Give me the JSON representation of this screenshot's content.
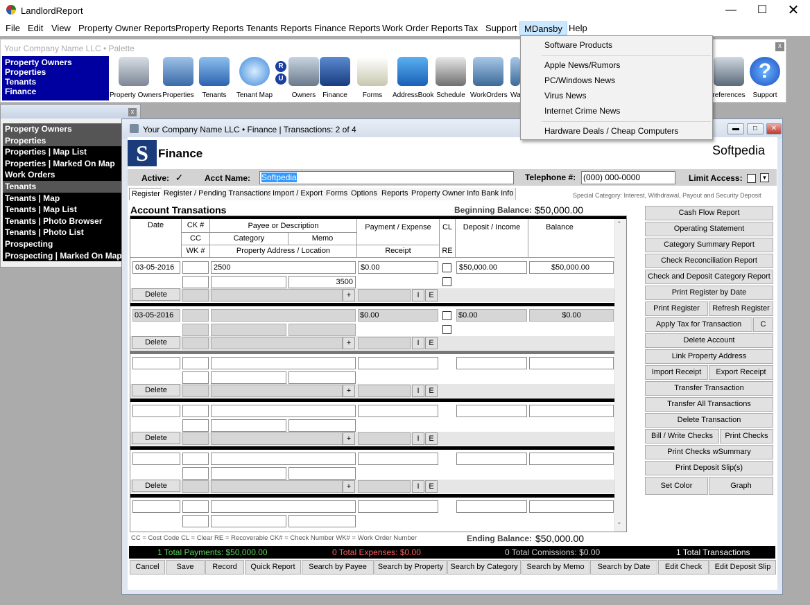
{
  "window": {
    "title": "LandlordReport",
    "min_icon": "minimize-icon",
    "max_icon": "maximize-icon",
    "close_icon": "close-icon"
  },
  "menu": [
    "File",
    "Edit",
    "View",
    "Property Owner Reports",
    "Property Reports",
    "Tenants Reports",
    "Finance Reports",
    "Work Order Reports",
    "Tax",
    "Support",
    "MDansby",
    "Help"
  ],
  "mdansby_menu": [
    "Software Products",
    "Apple News/Rumors",
    "PC/Windows News",
    "Virus News",
    "Internet Crime News",
    "Hardware Deals / Cheap Computers"
  ],
  "palette": {
    "title": "Your Company Name LLC  •  Palette",
    "close": "x",
    "nav": [
      "Property Owners",
      "Properties",
      "Tenants",
      "Finance"
    ],
    "tools": [
      "Property Owners",
      "Properties",
      "Tenants",
      "Tenant Map",
      "Owners",
      "Finance",
      "Forms",
      "AddressBook",
      "Schedule",
      "WorkOrders",
      "Wa",
      "references",
      "Support"
    ],
    "ru_badge": [
      "R",
      "U"
    ]
  },
  "side_nav": {
    "close": "x",
    "items": [
      {
        "label": "Property Owners",
        "type": "hdr"
      },
      {
        "label": "Properties",
        "type": "hdr"
      },
      {
        "label": "Properties | Map List",
        "type": "it"
      },
      {
        "label": "Properties | Marked On Map",
        "type": "it"
      },
      {
        "label": "Work Orders",
        "type": "it"
      },
      {
        "label": "Tenants",
        "type": "hdr"
      },
      {
        "label": "Tenants | Map",
        "type": "it"
      },
      {
        "label": "Tenants | Map List",
        "type": "it"
      },
      {
        "label": "Tenants | Photo Browser",
        "type": "it"
      },
      {
        "label": "Tenants | Photo List",
        "type": "it"
      },
      {
        "label": "Prospecting",
        "type": "it"
      },
      {
        "label": "Prospecting | Marked On Map",
        "type": "it"
      }
    ]
  },
  "finance": {
    "window_title": "Your Company Name LLC  •  Finance | Transactions: 2 of 4",
    "logo_letter": "S",
    "heading": "Finance",
    "brand": "Softpedia",
    "active_label": "Active:",
    "active_checked": "✓",
    "acct_label": "Acct Name:",
    "acct_value": "Softpedia",
    "tel_label": "Telephone #:",
    "tel_value": "(000) 000-0000",
    "limit_label": "Limit Access:",
    "tabs": [
      "Register",
      "Register / Pending Transactions",
      "Import / Export",
      "Forms",
      "Options",
      "Reports",
      "Property Owner Info",
      "Bank Info"
    ],
    "special_category": "Special Category:  Interest, Withdrawal, Payout and Security Deposit",
    "section_title": "Account Transations",
    "beginning_label": "Beginning Balance:",
    "beginning_value": "$50,000.00",
    "ending_label": "Ending Balance:",
    "ending_value": "$50,000.00",
    "columns": {
      "date": "Date",
      "ck": "CK #",
      "cc": "CC",
      "wk": "WK #",
      "payee": "Payee or Description",
      "category": "Category",
      "memo": "Memo",
      "address": "Property Address / Location",
      "payment": "Payment / Expense",
      "receipt": "Receipt",
      "cl": "CL",
      "re": "RE",
      "deposit": "Deposit / Income",
      "balance": "Balance"
    },
    "rows": [
      {
        "date": "03-05-2016",
        "payee": "2500",
        "memo": "3500",
        "payment": "$0.00",
        "deposit": "$50,000.00",
        "balance": "$50,000.00"
      },
      {
        "date": "03-05-2016",
        "payee": "",
        "memo": "",
        "payment": "$0.00",
        "deposit": "$0.00",
        "balance": "$0.00"
      }
    ],
    "row_buttons": {
      "delete": "Delete",
      "plus": "+",
      "i": "I",
      "e": "E"
    },
    "legend": "CC = Cost Code     CL = Clear     RE = Recoverable     CK# = Check Number     WK# = Work Order Number",
    "right_buttons": [
      "Cash Flow Report",
      "Operating Statement",
      "Category Summary Report",
      "Check Reconciliation Report",
      "Check and Deposit Category Report",
      "Print Register by Date",
      "Print Register",
      "Refresh Register",
      "Apply Tax for Transaction",
      "C",
      "Delete Account",
      "Link Property Address",
      "Import Receipt",
      "Export Receipt",
      "Transfer Transaction",
      "Transfer All Transactions",
      "Delete Transaction",
      "Bill / Write Checks",
      "Print Checks",
      "Print Checks wSummary",
      "Print Deposit Slip(s)",
      "Set Color",
      "Graph"
    ],
    "status": {
      "payments": "1 Total Payments: $50,000.00",
      "expenses": "0 Total Expenses: $0.00",
      "commissions": "0 Total Comissions: $0.00",
      "transactions": "1 Total Transactions",
      "payments_color": "#5cd65c",
      "expenses_color": "#ff6060",
      "neutral_color": "#d0d0d0"
    },
    "bottom_buttons": [
      "Cancel",
      "Save",
      "Record",
      "Quick Report",
      "Search by Payee",
      "Search by Property",
      "Search by Category",
      "Search by Memo",
      "Search by Date",
      "Edit Check",
      "Edit Deposit Slip"
    ]
  }
}
